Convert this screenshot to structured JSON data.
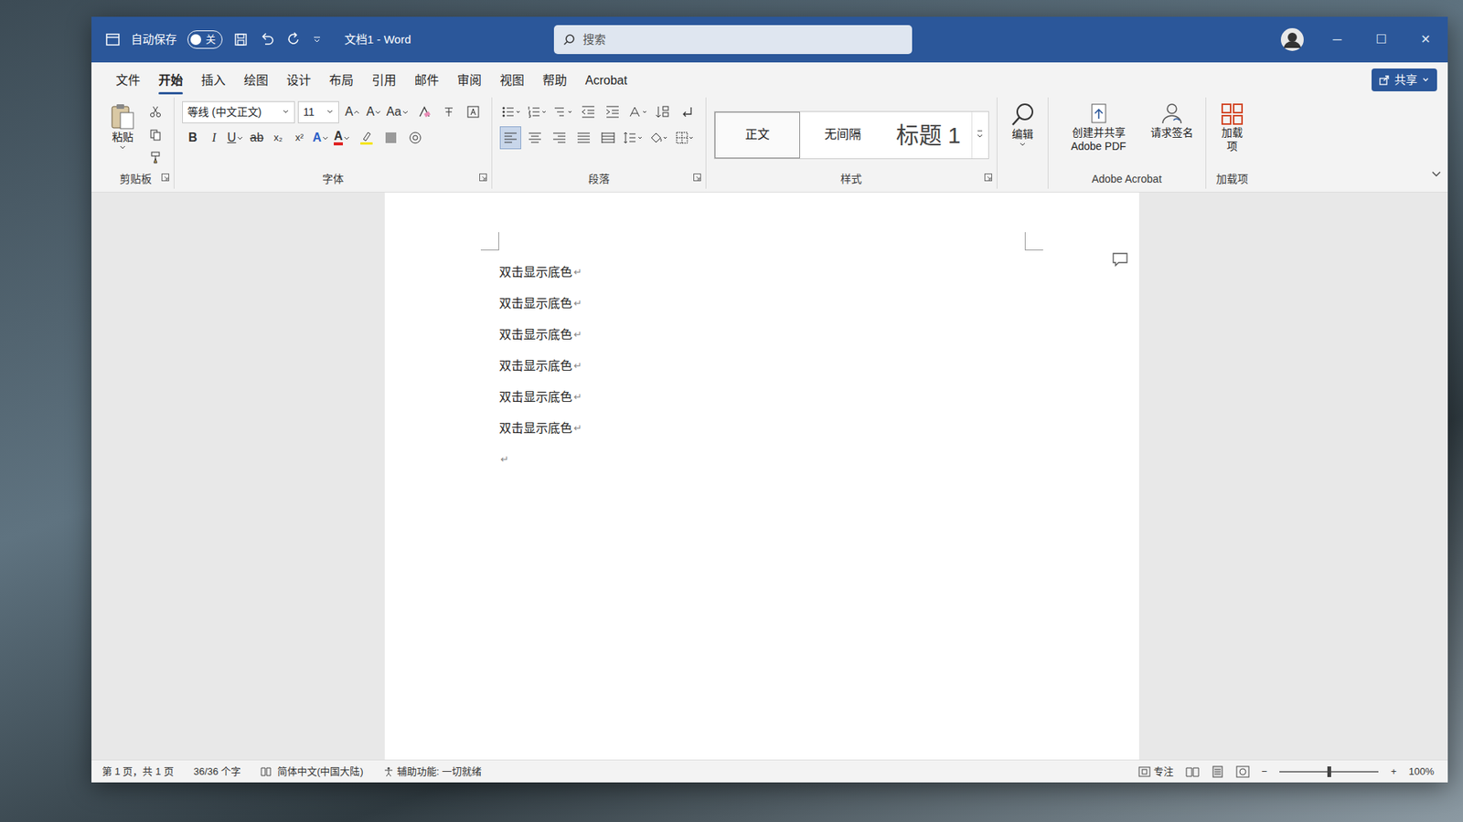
{
  "window": {
    "title": "文档1 - Word",
    "autosave": {
      "label": "自动保存",
      "state": "关",
      "on": false
    },
    "controls": [
      "─",
      "☐",
      "✕"
    ]
  },
  "search": {
    "placeholder": "搜索"
  },
  "menu": {
    "tabs": [
      {
        "label": "文件",
        "selected": false
      },
      {
        "label": "开始",
        "selected": true
      },
      {
        "label": "插入",
        "selected": false
      },
      {
        "label": "绘图",
        "selected": false
      },
      {
        "label": "设计",
        "selected": false
      },
      {
        "label": "布局",
        "selected": false
      },
      {
        "label": "引用",
        "selected": false
      },
      {
        "label": "邮件",
        "selected": false
      },
      {
        "label": "审阅",
        "selected": false
      },
      {
        "label": "视图",
        "selected": false
      },
      {
        "label": "帮助",
        "selected": false
      },
      {
        "label": "Acrobat",
        "selected": false
      }
    ],
    "share": "共享"
  },
  "ribbon": {
    "clipboard": {
      "paste": "粘贴",
      "label": "剪贴板"
    },
    "font": {
      "name": "等线 (中文正文)",
      "size": "11",
      "tools": [
        {
          "label": "A",
          "kind": "grow"
        },
        {
          "label": "A",
          "kind": "shrink"
        },
        {
          "label": "Aa",
          "kind": "case"
        }
      ],
      "styles": [
        {
          "label": "B",
          "kind": "bold"
        },
        {
          "label": "I",
          "kind": "italic"
        },
        {
          "label": "U",
          "kind": "underline"
        },
        {
          "label": "ab",
          "kind": "strike"
        },
        {
          "label": "x₂",
          "kind": "sub"
        },
        {
          "label": "x²",
          "kind": "sup"
        },
        {
          "label": "A",
          "kind": "effects"
        },
        {
          "label": "A",
          "kind": "fontcolor"
        }
      ],
      "label": "字体"
    },
    "paragraph": {
      "label": "段落"
    },
    "styles": {
      "items": [
        {
          "label": "正文",
          "selected": true
        },
        {
          "label": "无间隔",
          "selected": false
        },
        {
          "label": "标题 1",
          "selected": false
        }
      ],
      "label": "样式"
    },
    "editing": {
      "label": "编辑"
    },
    "acrobat": {
      "items": [
        "创建并共享 Adobe PDF",
        "请求签名"
      ],
      "label": "Adobe Acrobat"
    },
    "addins": {
      "items": [
        "加载项"
      ],
      "label": "加载项"
    }
  },
  "document": {
    "paragraphs": [
      {
        "text": "双击显示底色",
        "mark": "↵"
      },
      {
        "text": "双击显示底色",
        "mark": "↵"
      },
      {
        "text": "双击显示底色",
        "mark": "↵"
      },
      {
        "text": "双击显示底色",
        "mark": "↵"
      },
      {
        "text": "双击显示底色",
        "mark": "↵"
      },
      {
        "text": "双击显示底色",
        "mark": "↵"
      },
      {
        "text": "",
        "mark": "↵"
      }
    ]
  },
  "status_bar": {
    "page": "第 1 页，共 1 页",
    "words": "36/36 个字",
    "language": "简体中文(中国大陆)",
    "accessibility": "辅助功能: 一切就绪",
    "focus": "专注",
    "zoom": {
      "minus": "−",
      "plus": "+",
      "level": 0.5,
      "reading": "100%"
    }
  }
}
